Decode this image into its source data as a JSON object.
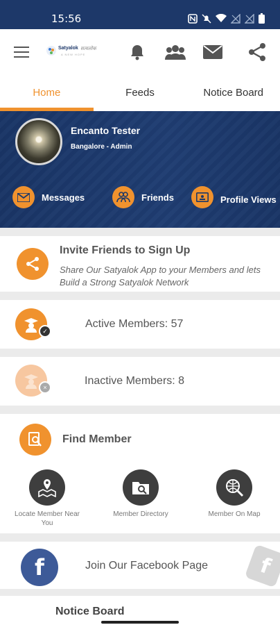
{
  "status_bar": {
    "time": "15:56"
  },
  "app": {
    "logo_brand": "Satyalok",
    "logo_script": "सत्यलोक",
    "logo_tagline": "A NEW HOPE"
  },
  "tabs": [
    {
      "label": "Home"
    },
    {
      "label": "Feeds"
    },
    {
      "label": "Notice Board"
    }
  ],
  "profile": {
    "name": "Encanto Tester",
    "role": "Bangalore - Admin",
    "stats": [
      {
        "label": "Messages"
      },
      {
        "label": "Friends"
      },
      {
        "label": "Profile Views"
      }
    ]
  },
  "invite": {
    "title": "Invite Friends to Sign Up",
    "subtitle": "Share Our Satyalok App to your Members and lets Build a Strong Satyalok Network"
  },
  "members": {
    "active_label": "Active Members: 57",
    "inactive_label": "Inactive Members: 8"
  },
  "find_member": {
    "title": "Find Member",
    "tools": [
      {
        "label": "Locate Member Near You"
      },
      {
        "label": "Member Directory"
      },
      {
        "label": "Member On Map"
      }
    ]
  },
  "facebook": {
    "label": "Join Our Facebook Page",
    "icon_letter": "f"
  },
  "notice_board": {
    "title": "Notice Board"
  },
  "colors": {
    "primary": "#1d3869",
    "accent": "#f0922e",
    "facebook": "#3d5a98"
  }
}
